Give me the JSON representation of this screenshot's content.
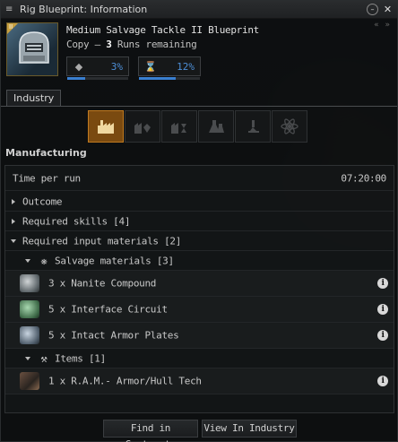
{
  "window": {
    "title": "Rig Blueprint: Information"
  },
  "header": {
    "item_name": "Medium Salvage Tackle II Blueprint",
    "copy_prefix": "Copy – ",
    "runs": "3",
    "runs_suffix": " Runs remaining",
    "tech_level": "II",
    "material_efficiency": "3%",
    "time_efficiency": "12%",
    "material_efficiency_fraction": 0.3,
    "time_efficiency_fraction": 0.6
  },
  "tabs": [
    {
      "label": "Industry"
    }
  ],
  "activities": [
    "manufacturing-icon",
    "material-research-icon",
    "time-research-icon",
    "copying-icon",
    "invention-icon",
    "reactions-icon"
  ],
  "section": {
    "title": "Manufacturing"
  },
  "panel": {
    "time_per_run_label": "Time per run",
    "time_per_run_value": "07:20:00",
    "outcome_label": "Outcome",
    "required_skills_label": "Required skills",
    "required_skills_count": "[4]",
    "required_input_label": "Required input materials",
    "required_input_count": "[2]",
    "groups": [
      {
        "label": "Salvage materials",
        "count": "[3]",
        "items": [
          {
            "text": "3 x Nanite Compound"
          },
          {
            "text": "5 x Interface Circuit"
          },
          {
            "text": "5 x Intact Armor Plates"
          }
        ]
      },
      {
        "label": "Items",
        "count": "[1]",
        "items": [
          {
            "text": "1 x R.A.M.- Armor/Hull Tech"
          }
        ]
      }
    ]
  },
  "buttons": {
    "find_in_contracts": "Find in Contracts",
    "view_in_industry": "View In Industry"
  },
  "colors": {
    "accent_blue": "#4d8ed6",
    "active_activity": "#7a4a10"
  }
}
